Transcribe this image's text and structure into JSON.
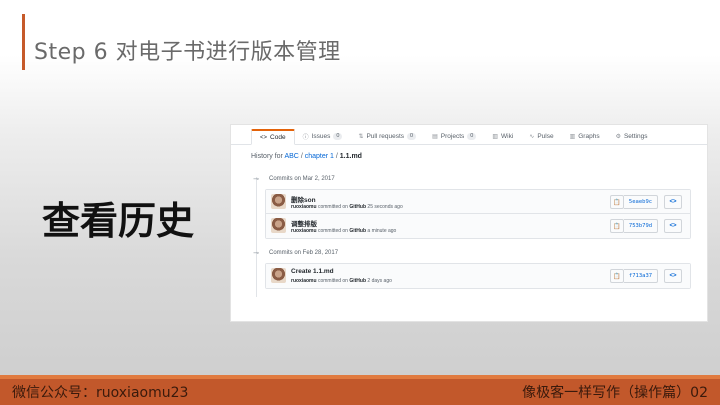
{
  "slide": {
    "title": "Step 6 对电子书进行版本管理",
    "heading": "查看历史",
    "footer_left": "微信公众号：ruoxiaomu23",
    "footer_right": "像极客一样写作（操作篇）02"
  },
  "github": {
    "tabs": [
      {
        "icon": "<>",
        "label": "Code"
      },
      {
        "icon": "ⓘ",
        "label": "Issues",
        "count": "0"
      },
      {
        "icon": "⇅",
        "label": "Pull requests",
        "count": "0"
      },
      {
        "icon": "▤",
        "label": "Projects",
        "count": "0"
      },
      {
        "icon": "▥",
        "label": "Wiki"
      },
      {
        "icon": "∿",
        "label": "Pulse"
      },
      {
        "icon": "▥",
        "label": "Graphs"
      },
      {
        "icon": "⚙",
        "label": "Settings"
      }
    ],
    "history": {
      "prefix": "History for",
      "repo": "ABC",
      "sep1": "/",
      "folder": "chapter 1",
      "sep2": "/",
      "file": "1.1.md"
    },
    "groups": [
      {
        "date": "Commits on Mar 2, 2017",
        "commits": [
          {
            "message": "删除son",
            "author": "ruoxiaomu",
            "verb": "committed on",
            "via": "GitHub",
            "when": "25 seconds ago",
            "sha": "5eaeb9c"
          },
          {
            "message": "调整排版",
            "author": "ruoxiaomu",
            "verb": "committed on",
            "via": "GitHub",
            "when": "a minute ago",
            "sha": "753b79d"
          }
        ]
      },
      {
        "date": "Commits on Feb 28, 2017",
        "commits": [
          {
            "message": "Create 1.1.md",
            "author": "ruoxiaomu",
            "verb": "committed on",
            "via": "GitHub",
            "when": "2 days ago",
            "sha": "f713a37"
          }
        ]
      }
    ]
  },
  "colors": {
    "accent": "#c65a2a",
    "link": "#0366d6",
    "tab_active_border": "#e36209"
  }
}
